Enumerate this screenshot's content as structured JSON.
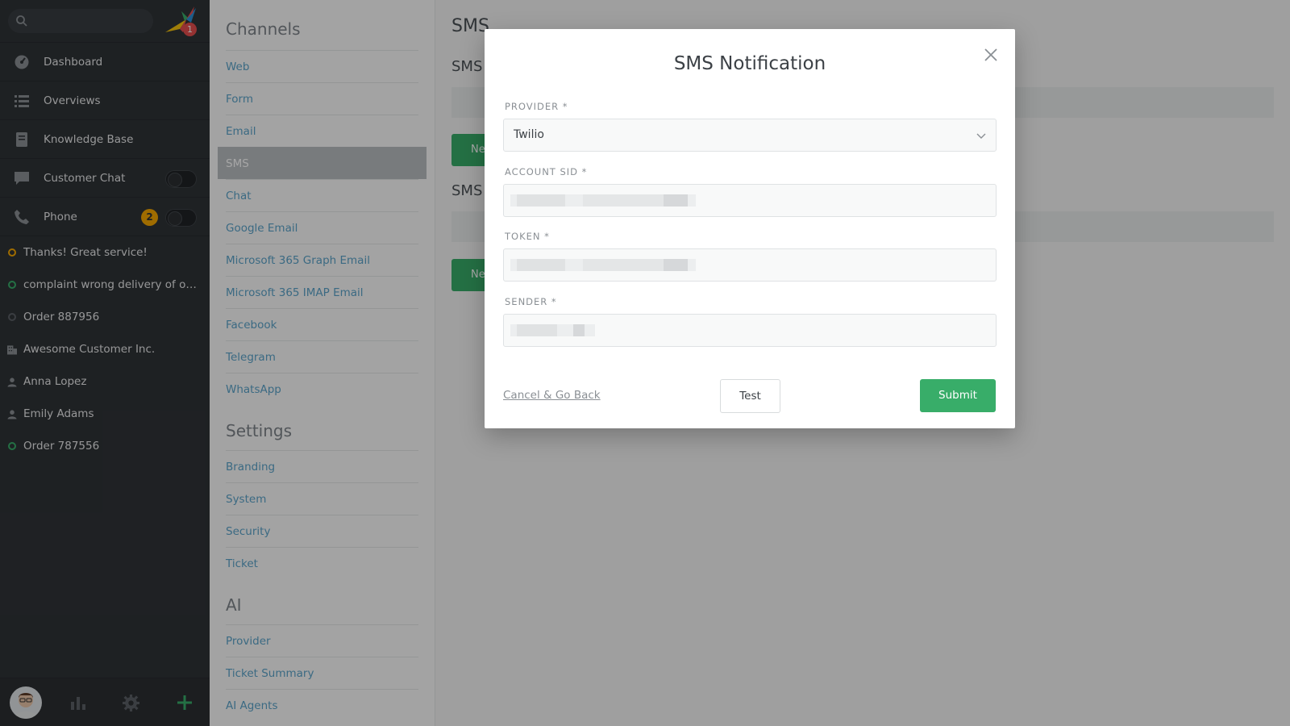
{
  "nav": {
    "search": {
      "placeholder": "",
      "icon": "search-icon"
    },
    "logo_badge": "1",
    "menu": [
      {
        "label": "Dashboard",
        "icon": "dashboard-icon"
      },
      {
        "label": "Overviews",
        "icon": "overviews-icon"
      },
      {
        "label": "Knowledge Base",
        "icon": "knowledge-base-icon"
      },
      {
        "label": "Customer Chat",
        "icon": "chat-icon",
        "toggle": "off"
      },
      {
        "label": "Phone",
        "icon": "phone-icon",
        "badge": "2",
        "toggle": "off"
      }
    ],
    "tasks": [
      {
        "label": "Thanks! Great service!",
        "icon": "ticket-status-icon",
        "color": "#f4a700"
      },
      {
        "label": "complaint wrong delivery of ord...",
        "icon": "ticket-status-icon",
        "color": "#38ad69"
      },
      {
        "label": "Order 887956",
        "icon": "ticket-status-icon",
        "color": "#5b6066"
      },
      {
        "label": "Awesome Customer Inc.",
        "icon": "organization-icon"
      },
      {
        "label": "Anna Lopez",
        "icon": "person-icon"
      },
      {
        "label": "Emily Adams",
        "icon": "person-icon"
      },
      {
        "label": "Order 787556",
        "icon": "ticket-status-icon",
        "color": "#38ad69"
      }
    ]
  },
  "settings": {
    "channels_heading": "Channels",
    "channels": [
      "Web",
      "Form",
      "Email",
      "SMS",
      "Chat",
      "Google Email",
      "Microsoft 365 Graph Email",
      "Microsoft 365 IMAP Email",
      "Facebook",
      "Telegram",
      "WhatsApp"
    ],
    "active": "SMS",
    "settings_heading": "Settings",
    "settings_items": [
      "Branding",
      "System",
      "Security",
      "Ticket"
    ],
    "ai_heading": "AI",
    "ai_items": [
      "Provider",
      "Ticket Summary",
      "AI Agents"
    ]
  },
  "main": {
    "title": "SMS",
    "section1": "SMS",
    "button1": "Ne",
    "section2": "SMS",
    "button2": "Ne"
  },
  "modal": {
    "title": "SMS Notification",
    "provider_label": "PROVIDER *",
    "provider_value": "Twilio",
    "account_sid_label": "ACCOUNT SID *",
    "token_label": "TOKEN *",
    "sender_label": "SENDER *",
    "cancel_label": "Cancel & Go Back",
    "test_label": "Test",
    "submit_label": "Submit"
  },
  "colors": {
    "accent_green": "#38ad69",
    "link_blue": "#5ba3c9",
    "nav_dark": "#2f3337",
    "warning": "#f4a700",
    "alert": "#e54d4d"
  }
}
